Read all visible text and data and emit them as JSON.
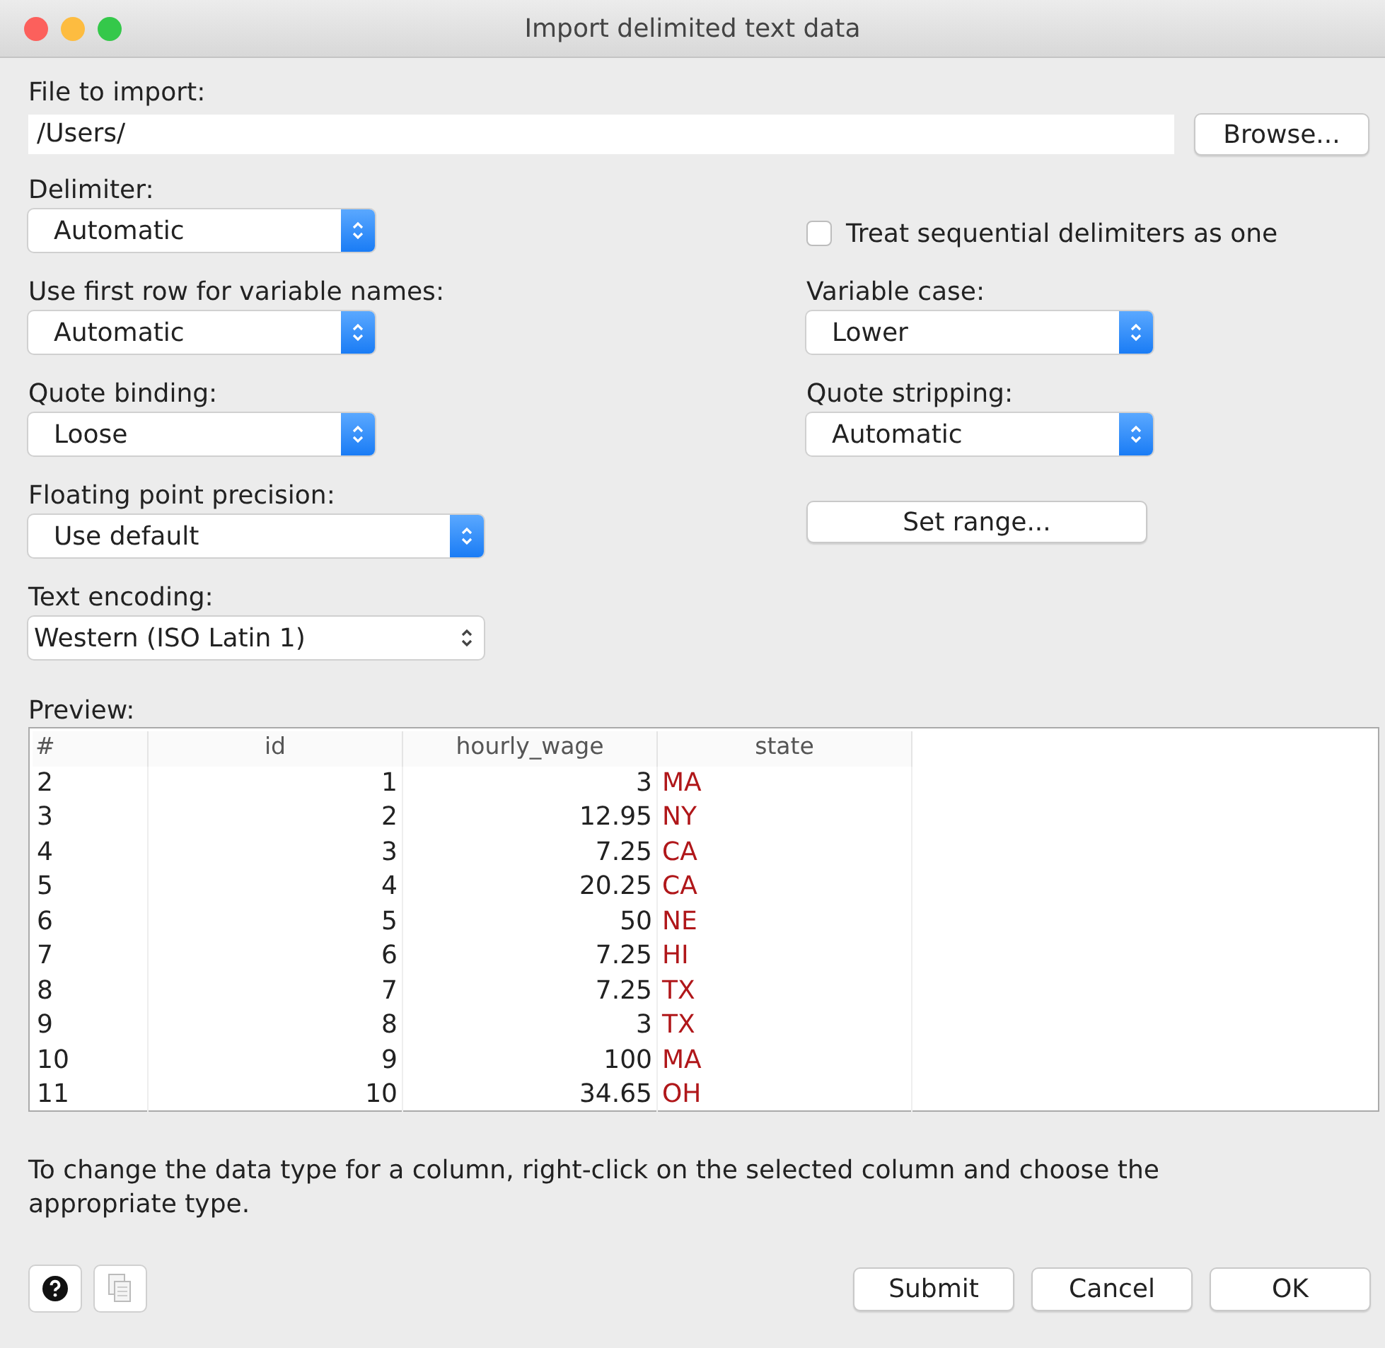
{
  "window": {
    "title": "Import delimited text data"
  },
  "file": {
    "label": "File to import:",
    "value": "/Users/",
    "browse": "Browse..."
  },
  "options": [
    {
      "kind": "popup",
      "label": "Delimiter:",
      "value": "Automatic"
    },
    {
      "kind": "checkbox",
      "label": "Treat sequential delimiters as one",
      "checked": false
    },
    {
      "kind": "popup",
      "label": "Use first row for variable names:",
      "value": "Automatic"
    },
    {
      "kind": "popup",
      "label": "Variable case:",
      "value": "Lower"
    },
    {
      "kind": "popup",
      "label": "Quote binding:",
      "value": "Loose"
    },
    {
      "kind": "popup",
      "label": "Quote stripping:",
      "value": "Automatic"
    },
    {
      "kind": "popup",
      "label": "Floating point precision:",
      "value": "Use default"
    },
    {
      "kind": "button",
      "label": "Set range..."
    },
    {
      "kind": "combo",
      "label": "Text encoding:",
      "value": "Western (ISO Latin 1)"
    }
  ],
  "preview": {
    "label": "Preview:",
    "columns": [
      "#",
      "id",
      "hourly_wage",
      "state"
    ],
    "rows": [
      [
        "2",
        "1",
        "3",
        "MA"
      ],
      [
        "3",
        "2",
        "12.95",
        "NY"
      ],
      [
        "4",
        "3",
        "7.25",
        "CA"
      ],
      [
        "5",
        "4",
        "20.25",
        "CA"
      ],
      [
        "6",
        "5",
        "50",
        "NE"
      ],
      [
        "7",
        "6",
        "7.25",
        "HI"
      ],
      [
        "8",
        "7",
        "7.25",
        "TX"
      ],
      [
        "9",
        "8",
        "3",
        "TX"
      ],
      [
        "10",
        "9",
        "100",
        "MA"
      ],
      [
        "11",
        "10",
        "34.65",
        "OH"
      ]
    ]
  },
  "hint": "To change the data type for a column, right-click on the selected column and choose the appropriate type.",
  "buttons": [
    "Submit",
    "Cancel",
    "OK"
  ]
}
